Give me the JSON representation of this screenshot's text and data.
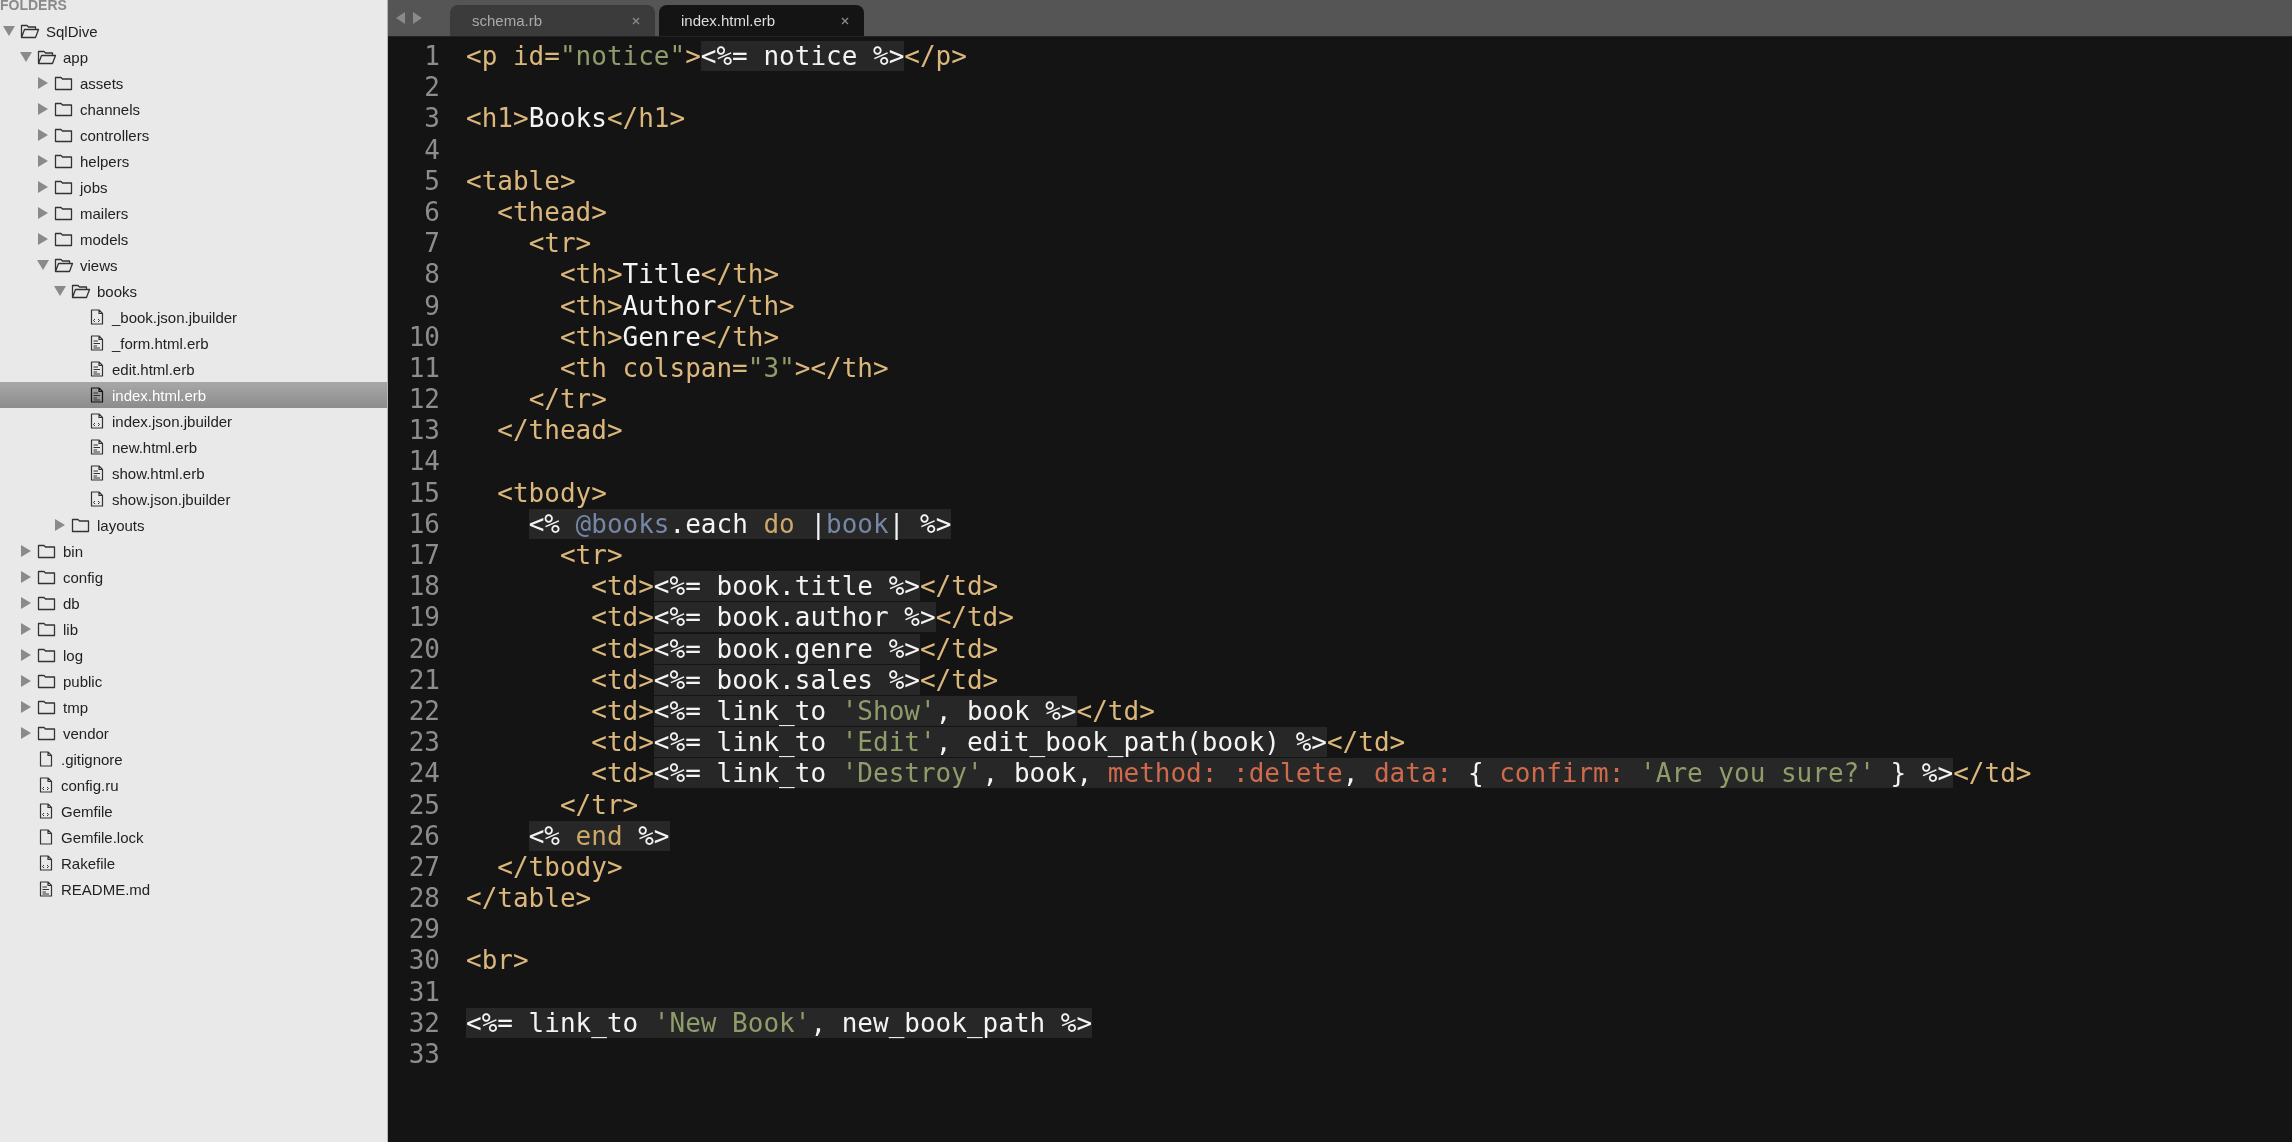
{
  "sidebar": {
    "header": "FOLDERS",
    "tree": [
      {
        "label": "SqlDive",
        "kind": "folder",
        "expanded": true,
        "selected": false,
        "children": [
          {
            "label": "app",
            "kind": "folder",
            "expanded": true,
            "selected": false,
            "children": [
              {
                "label": "assets",
                "kind": "folder",
                "expanded": false,
                "selected": false
              },
              {
                "label": "channels",
                "kind": "folder",
                "expanded": false,
                "selected": false
              },
              {
                "label": "controllers",
                "kind": "folder",
                "expanded": false,
                "selected": false
              },
              {
                "label": "helpers",
                "kind": "folder",
                "expanded": false,
                "selected": false
              },
              {
                "label": "jobs",
                "kind": "folder",
                "expanded": false,
                "selected": false
              },
              {
                "label": "mailers",
                "kind": "folder",
                "expanded": false,
                "selected": false
              },
              {
                "label": "models",
                "kind": "folder",
                "expanded": false,
                "selected": false
              },
              {
                "label": "views",
                "kind": "folder",
                "expanded": true,
                "selected": false,
                "children": [
                  {
                    "label": "books",
                    "kind": "folder",
                    "expanded": true,
                    "selected": false,
                    "children": [
                      {
                        "label": "_book.json.jbuilder",
                        "kind": "code-file",
                        "selected": false
                      },
                      {
                        "label": "_form.html.erb",
                        "kind": "text-file",
                        "selected": false
                      },
                      {
                        "label": "edit.html.erb",
                        "kind": "text-file",
                        "selected": false
                      },
                      {
                        "label": "index.html.erb",
                        "kind": "text-file",
                        "selected": true
                      },
                      {
                        "label": "index.json.jbuilder",
                        "kind": "code-file",
                        "selected": false
                      },
                      {
                        "label": "new.html.erb",
                        "kind": "text-file",
                        "selected": false
                      },
                      {
                        "label": "show.html.erb",
                        "kind": "text-file",
                        "selected": false
                      },
                      {
                        "label": "show.json.jbuilder",
                        "kind": "code-file",
                        "selected": false
                      }
                    ]
                  },
                  {
                    "label": "layouts",
                    "kind": "folder",
                    "expanded": false,
                    "selected": false
                  }
                ]
              }
            ]
          },
          {
            "label": "bin",
            "kind": "folder",
            "expanded": false,
            "selected": false
          },
          {
            "label": "config",
            "kind": "folder",
            "expanded": false,
            "selected": false
          },
          {
            "label": "db",
            "kind": "folder",
            "expanded": false,
            "selected": false
          },
          {
            "label": "lib",
            "kind": "folder",
            "expanded": false,
            "selected": false
          },
          {
            "label": "log",
            "kind": "folder",
            "expanded": false,
            "selected": false
          },
          {
            "label": "public",
            "kind": "folder",
            "expanded": false,
            "selected": false
          },
          {
            "label": "tmp",
            "kind": "folder",
            "expanded": false,
            "selected": false
          },
          {
            "label": "vendor",
            "kind": "folder",
            "expanded": false,
            "selected": false
          },
          {
            "label": ".gitignore",
            "kind": "plain-file",
            "selected": false
          },
          {
            "label": "config.ru",
            "kind": "code-file",
            "selected": false
          },
          {
            "label": "Gemfile",
            "kind": "code-file",
            "selected": false
          },
          {
            "label": "Gemfile.lock",
            "kind": "plain-file",
            "selected": false
          },
          {
            "label": "Rakefile",
            "kind": "code-file",
            "selected": false
          },
          {
            "label": "README.md",
            "kind": "text-file",
            "selected": false
          }
        ]
      }
    ]
  },
  "tabs": [
    {
      "label": "schema.rb",
      "selected": false
    },
    {
      "label": "index.html.erb",
      "selected": true
    }
  ],
  "editor": {
    "lines": [
      {
        "number": "1",
        "segments": [
          {
            "kind": "tag",
            "text": "<p id=",
            "embedded": false
          },
          {
            "kind": "string",
            "text": "\"notice\"",
            "embedded": false
          },
          {
            "kind": "tag",
            "text": ">",
            "embedded": false
          },
          {
            "kind": "text",
            "text": "<%= notice %>",
            "embedded": true
          },
          {
            "kind": "tag",
            "text": "</p>",
            "embedded": false
          }
        ]
      },
      {
        "number": "2"
      },
      {
        "number": "3",
        "segments": [
          {
            "kind": "tag",
            "text": "<h1>",
            "embedded": false
          },
          {
            "kind": "text",
            "text": "Books",
            "embedded": false
          },
          {
            "kind": "tag",
            "text": "</h1>",
            "embedded": false
          }
        ]
      },
      {
        "number": "4"
      },
      {
        "number": "5",
        "segments": [
          {
            "kind": "tag",
            "text": "<table>",
            "embedded": false
          }
        ]
      },
      {
        "number": "6",
        "segments": [
          {
            "kind": "tag",
            "text": "  <thead>",
            "embedded": false
          }
        ]
      },
      {
        "number": "7",
        "segments": [
          {
            "kind": "tag",
            "text": "    <tr>",
            "embedded": false
          }
        ]
      },
      {
        "number": "8",
        "segments": [
          {
            "kind": "tag",
            "text": "      <th>",
            "embedded": false
          },
          {
            "kind": "text",
            "text": "Title",
            "embedded": false
          },
          {
            "kind": "tag",
            "text": "</th>",
            "embedded": false
          }
        ]
      },
      {
        "number": "9",
        "segments": [
          {
            "kind": "tag",
            "text": "      <th>",
            "embedded": false
          },
          {
            "kind": "text",
            "text": "Author",
            "embedded": false
          },
          {
            "kind": "tag",
            "text": "</th>",
            "embedded": false
          }
        ]
      },
      {
        "number": "10",
        "segments": [
          {
            "kind": "tag",
            "text": "      <th>",
            "embedded": false
          },
          {
            "kind": "text",
            "text": "Genre",
            "embedded": false
          },
          {
            "kind": "tag",
            "text": "</th>",
            "embedded": false
          }
        ]
      },
      {
        "number": "11",
        "segments": [
          {
            "kind": "tag",
            "text": "      <th colspan=",
            "embedded": false
          },
          {
            "kind": "string",
            "text": "\"3\"",
            "embedded": false
          },
          {
            "kind": "tag",
            "text": "></th>",
            "embedded": false
          }
        ]
      },
      {
        "number": "12",
        "segments": [
          {
            "kind": "tag",
            "text": "    </tr>",
            "embedded": false
          }
        ]
      },
      {
        "number": "13",
        "segments": [
          {
            "kind": "tag",
            "text": "  </thead>",
            "embedded": false
          }
        ]
      },
      {
        "number": "14"
      },
      {
        "number": "15",
        "segments": [
          {
            "kind": "tag",
            "text": "  <tbody>",
            "embedded": false
          }
        ]
      },
      {
        "number": "16",
        "segments": [
          {
            "kind": "text",
            "text": "    <% ",
            "embedded": true
          },
          {
            "kind": "variable",
            "text": "@books",
            "embedded": true
          },
          {
            "kind": "text",
            "text": ".each ",
            "embedded": true
          },
          {
            "kind": "keyword",
            "text": "do",
            "embedded": true
          },
          {
            "kind": "text",
            "text": " |",
            "embedded": true
          },
          {
            "kind": "variable",
            "text": "book",
            "embedded": true
          },
          {
            "kind": "text",
            "text": "| %>",
            "embedded": true
          }
        ]
      },
      {
        "number": "17",
        "segments": [
          {
            "kind": "tag",
            "text": "      <tr>",
            "embedded": false
          }
        ]
      },
      {
        "number": "18",
        "segments": [
          {
            "kind": "tag",
            "text": "        <td>",
            "embedded": false
          },
          {
            "kind": "text",
            "text": "<%= book.title %>",
            "embedded": true
          },
          {
            "kind": "tag",
            "text": "</td>",
            "embedded": false
          }
        ]
      },
      {
        "number": "19",
        "segments": [
          {
            "kind": "tag",
            "text": "        <td>",
            "embedded": false
          },
          {
            "kind": "text",
            "text": "<%= book.author %>",
            "embedded": true
          },
          {
            "kind": "tag",
            "text": "</td>",
            "embedded": false
          }
        ]
      },
      {
        "number": "20",
        "segments": [
          {
            "kind": "tag",
            "text": "        <td>",
            "embedded": false
          },
          {
            "kind": "text",
            "text": "<%= book.genre %>",
            "embedded": true
          },
          {
            "kind": "tag",
            "text": "</td>",
            "embedded": false
          }
        ]
      },
      {
        "number": "21",
        "segments": [
          {
            "kind": "tag",
            "text": "        <td>",
            "embedded": false
          },
          {
            "kind": "text",
            "text": "<%= book.sales %>",
            "embedded": true
          },
          {
            "kind": "tag",
            "text": "</td>",
            "embedded": false
          }
        ]
      },
      {
        "number": "22",
        "segments": [
          {
            "kind": "tag",
            "text": "        <td>",
            "embedded": false
          },
          {
            "kind": "text",
            "text": "<%= link_to ",
            "embedded": true
          },
          {
            "kind": "string",
            "text": "'Show'",
            "embedded": true
          },
          {
            "kind": "text",
            "text": ", book %>",
            "embedded": true
          },
          {
            "kind": "tag",
            "text": "</td>",
            "embedded": false
          }
        ]
      },
      {
        "number": "23",
        "segments": [
          {
            "kind": "tag",
            "text": "        <td>",
            "embedded": false
          },
          {
            "kind": "text",
            "text": "<%= link_to ",
            "embedded": true
          },
          {
            "kind": "string",
            "text": "'Edit'",
            "embedded": true
          },
          {
            "kind": "text",
            "text": ", edit_book_path(book) %>",
            "embedded": true
          },
          {
            "kind": "tag",
            "text": "</td>",
            "embedded": false
          }
        ]
      },
      {
        "number": "24",
        "segments": [
          {
            "kind": "tag",
            "text": "        <td>",
            "embedded": false
          },
          {
            "kind": "text",
            "text": "<%= link_to ",
            "embedded": true
          },
          {
            "kind": "string",
            "text": "'Destroy'",
            "embedded": true
          },
          {
            "kind": "text",
            "text": ", book, ",
            "embedded": true
          },
          {
            "kind": "symbol",
            "text": "method: :delete",
            "embedded": true
          },
          {
            "kind": "text",
            "text": ", ",
            "embedded": true
          },
          {
            "kind": "symbol",
            "text": "data:",
            "embedded": true
          },
          {
            "kind": "text",
            "text": " { ",
            "embedded": true
          },
          {
            "kind": "symbol",
            "text": "confirm:",
            "embedded": true
          },
          {
            "kind": "string",
            "text": " 'Are you sure?'",
            "embedded": true
          },
          {
            "kind": "text",
            "text": " } %>",
            "embedded": true
          },
          {
            "kind": "tag",
            "text": "</td>",
            "embedded": false
          }
        ]
      },
      {
        "number": "25",
        "segments": [
          {
            "kind": "tag",
            "text": "      </tr>",
            "embedded": false
          }
        ]
      },
      {
        "number": "26",
        "segments": [
          {
            "kind": "text",
            "text": "    <% ",
            "embedded": true
          },
          {
            "kind": "keyword",
            "text": "end",
            "embedded": true
          },
          {
            "kind": "text",
            "text": " %>",
            "embedded": true
          }
        ]
      },
      {
        "number": "27",
        "segments": [
          {
            "kind": "tag",
            "text": "  </tbody>",
            "embedded": false
          }
        ]
      },
      {
        "number": "28",
        "segments": [
          {
            "kind": "tag",
            "text": "</table>",
            "embedded": false
          }
        ]
      },
      {
        "number": "29"
      },
      {
        "number": "30",
        "segments": [
          {
            "kind": "tag",
            "text": "<br>",
            "embedded": false
          }
        ]
      },
      {
        "number": "31"
      },
      {
        "number": "32",
        "segments": [
          {
            "kind": "text",
            "text": "<%= link_to ",
            "embedded": true
          },
          {
            "kind": "string",
            "text": "'New Book'",
            "embedded": true
          },
          {
            "kind": "text",
            "text": ", new_book_path %>",
            "embedded": true
          }
        ]
      },
      {
        "number": "33"
      }
    ]
  }
}
